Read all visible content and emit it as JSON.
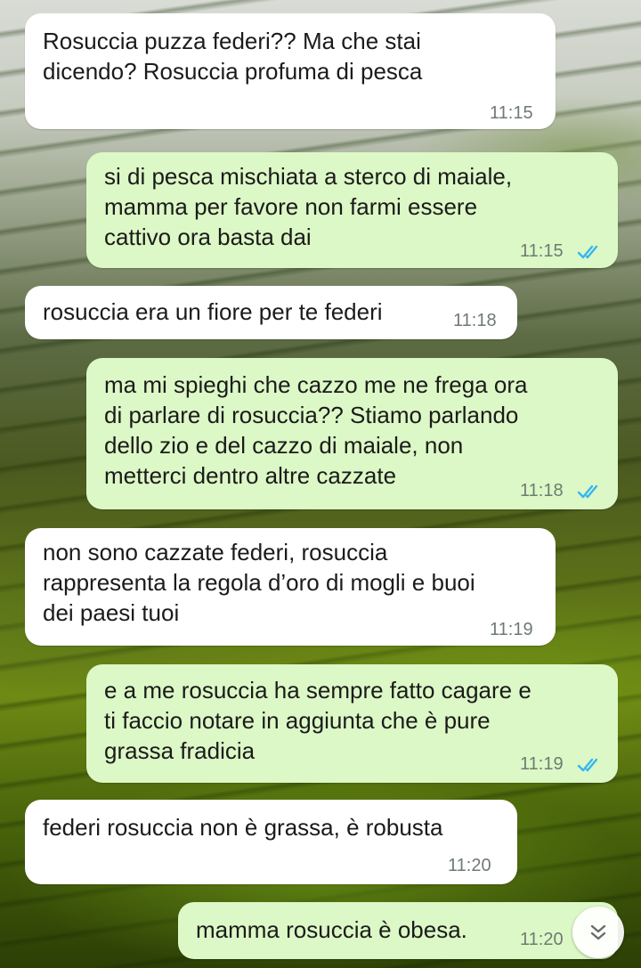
{
  "colors": {
    "incoming_bubble": "#ffffff",
    "outgoing_bubble": "#dcf8c6",
    "read_tick": "#34b7f1",
    "timestamp": "#6f7a73"
  },
  "messages": [
    {
      "direction": "incoming",
      "text": "Rosuccia puzza federi?? Ma che stai\ndicendo? Rosuccia profuma di pesca",
      "time": "11:15"
    },
    {
      "direction": "outgoing",
      "text": "si di pesca mischiata a sterco di maiale,\nmamma per favore non farmi essere\ncattivo ora basta dai",
      "time": "11:15",
      "status": "read"
    },
    {
      "direction": "incoming",
      "text": "rosuccia era un fiore per te federi",
      "time": "11:18"
    },
    {
      "direction": "outgoing",
      "text": "ma mi spieghi che cazzo me ne frega ora\ndi parlare di rosuccia?? Stiamo parlando\ndello zio e del cazzo di maiale, non\nmetterci dentro altre cazzate",
      "time": "11:18",
      "status": "read"
    },
    {
      "direction": "incoming",
      "text": "non sono cazzate federi, rosuccia\nrappresenta la regola d’oro di mogli e buoi\ndei paesi tuoi",
      "time": "11:19"
    },
    {
      "direction": "outgoing",
      "text": "e a me rosuccia ha sempre fatto cagare e\nti faccio notare in aggiunta che è pure\ngrassa fradicia",
      "time": "11:19",
      "status": "read"
    },
    {
      "direction": "incoming",
      "text": "federi rosuccia non è grassa, è robusta",
      "time": "11:20"
    },
    {
      "direction": "outgoing",
      "text": "mamma rosuccia è obesa.",
      "time": "11:20",
      "status": "read"
    }
  ],
  "scroll_button": {
    "icon": "double-chevron-down-icon"
  }
}
